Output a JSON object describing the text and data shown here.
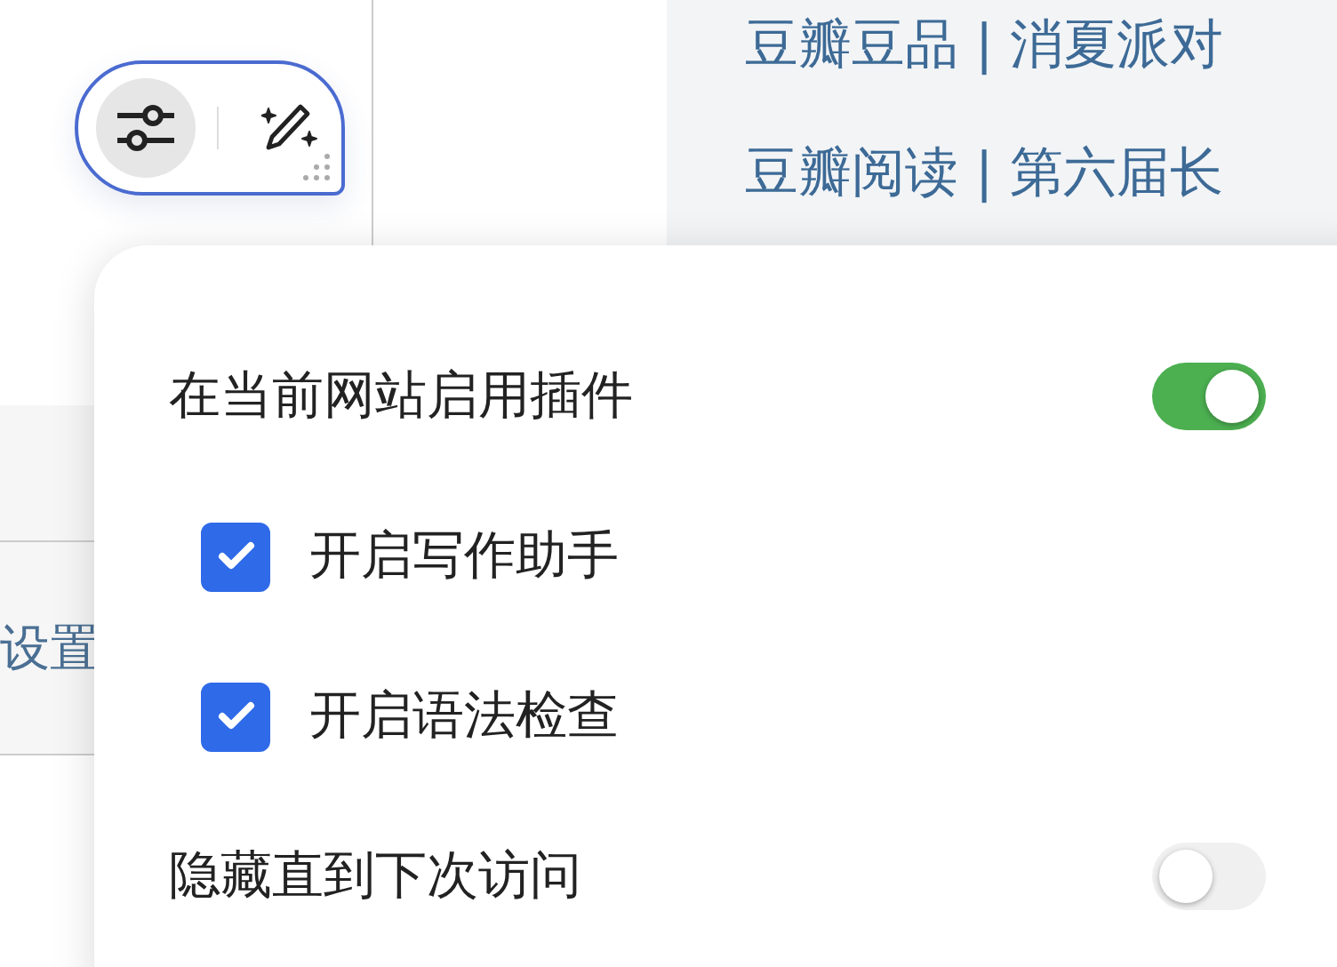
{
  "toolbar": {
    "buttons": [
      {
        "kind": "sliders",
        "selected": true
      },
      {
        "kind": "magic-pen",
        "selected": false
      }
    ]
  },
  "links": [
    "豆瓣豆品 | 消夏派对",
    "豆瓣阅读 | 第六届长"
  ],
  "sidebar": {
    "items": [
      {
        "label": "设置"
      }
    ]
  },
  "popup": {
    "rows": [
      {
        "kind": "toggle",
        "label": "在当前网站启用插件",
        "on": true
      },
      {
        "kind": "checkbox",
        "label": "开启写作助手",
        "checked": true
      },
      {
        "kind": "checkbox",
        "label": "开启语法检查",
        "checked": true
      },
      {
        "kind": "toggle",
        "label": "隐藏直到下次访问",
        "on": false
      }
    ]
  }
}
